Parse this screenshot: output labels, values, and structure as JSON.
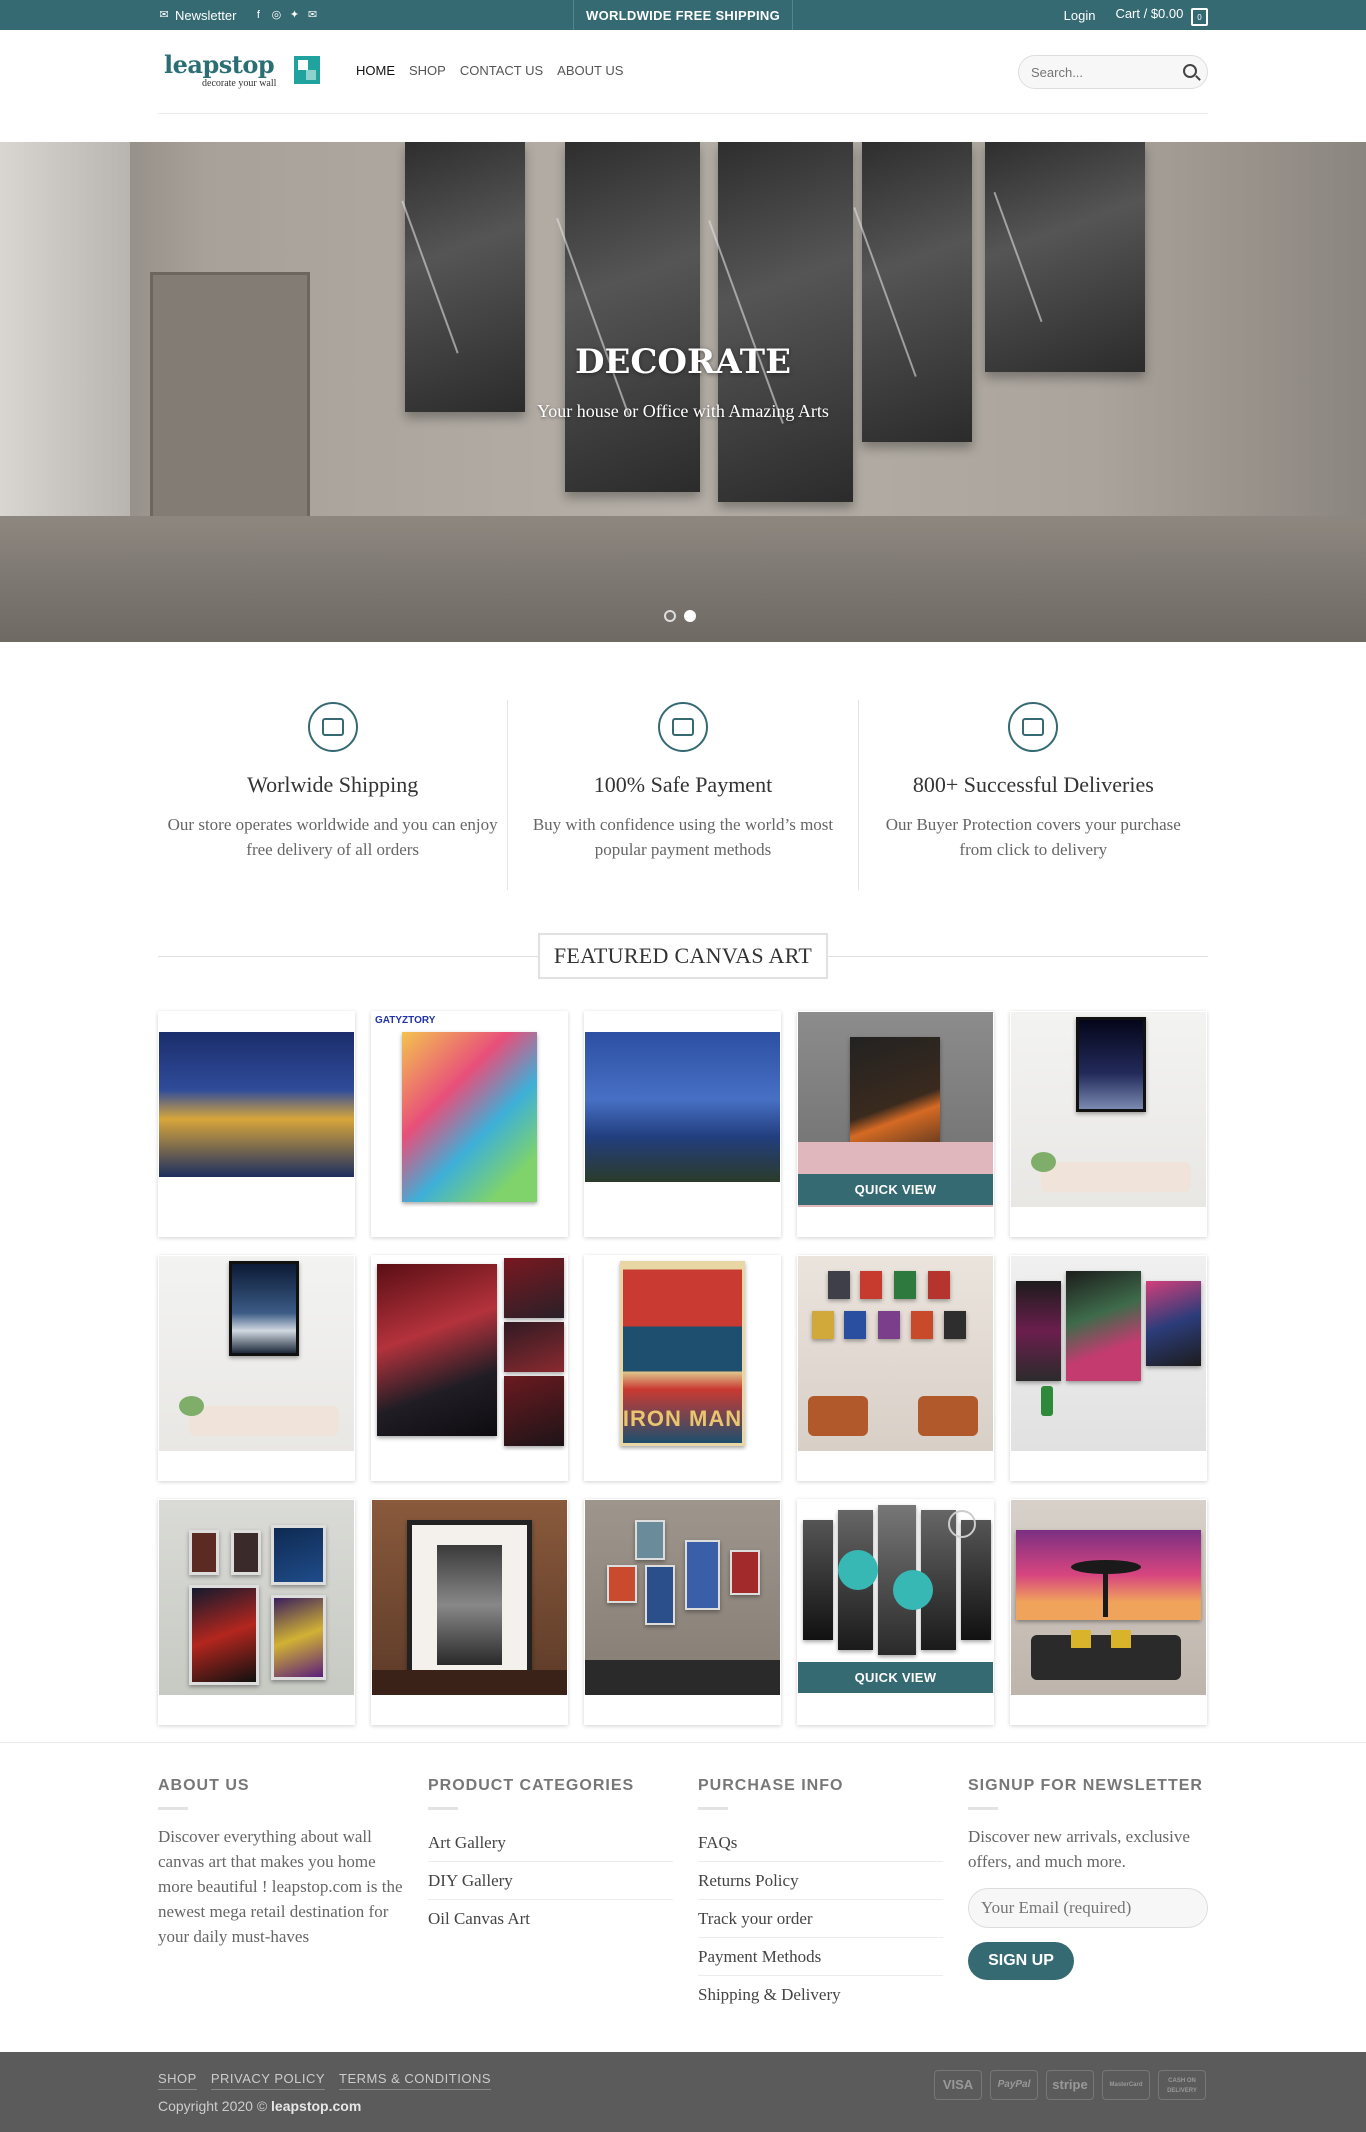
{
  "topbar": {
    "newsletter": "Newsletter",
    "social_icons": [
      "facebook-icon",
      "instagram-icon",
      "twitter-icon",
      "mail-icon"
    ],
    "shipping": "WORLDWIDE FREE SHIPPING",
    "login": "Login",
    "cart": "Cart / $0.00",
    "cart_count": "0"
  },
  "header": {
    "logo_text": "leapstop",
    "logo_tagline": "decorate your wall",
    "nav": [
      "HOME",
      "SHOP",
      "CONTACT US",
      "ABOUT US"
    ],
    "search_placeholder": "Search..."
  },
  "hero": {
    "title": "DECORATE",
    "subtitle": "Your house or Office with Amazing Arts",
    "slides": 2,
    "active_slide": 2
  },
  "features": [
    {
      "icon": "truck-icon",
      "title": "Worlwide Shipping",
      "text": "Our store operates worldwide and you can enjoy free delivery of all orders"
    },
    {
      "icon": "credit-card-icon",
      "title": "100% Safe Payment",
      "text": "Buy with confidence using the world’s most popular payment methods"
    },
    {
      "icon": "protection-icon",
      "title": "800+ Successful Deliveries",
      "text": "Our Buyer Protection covers your purchase from click to delivery"
    }
  ],
  "featured": {
    "title": "FEATURED CANVAS ART",
    "quick_view": "QUICK VIEW",
    "brand_labels": [
      "GATYZTORY",
      "IRON MAN"
    ]
  },
  "footer": {
    "about": {
      "title": "ABOUT US",
      "text": "Discover everything about wall canvas art that makes you home more beautiful ! leapstop.com is the newest mega retail destination for your daily must-haves"
    },
    "categories": {
      "title": "PRODUCT CATEGORIES",
      "items": [
        "Art Gallery",
        "DIY Gallery",
        "Oil Canvas Art"
      ]
    },
    "purchase": {
      "title": "PURCHASE INFO",
      "items": [
        "FAQs",
        "Returns Policy",
        "Track your order",
        "Payment Methods",
        "Shipping & Delivery"
      ]
    },
    "newsletter": {
      "title": "SIGNUP FOR NEWSLETTER",
      "text": "Discover new arrivals, exclusive offers, and much more.",
      "placeholder": "Your Email (required)",
      "button": "SIGN UP"
    }
  },
  "bottom": {
    "links": [
      "SHOP",
      "PRIVACY POLICY",
      "TERMS & CONDITIONS"
    ],
    "copyright": "Copyright 2020 ©",
    "site": "leapstop.com",
    "payments": [
      "VISA",
      "PayPal",
      "stripe",
      "MasterCard",
      "CASH ON DELIVERY"
    ]
  },
  "colors": {
    "accent": "#356a72",
    "bottom_bar": "#5b5b5b"
  }
}
